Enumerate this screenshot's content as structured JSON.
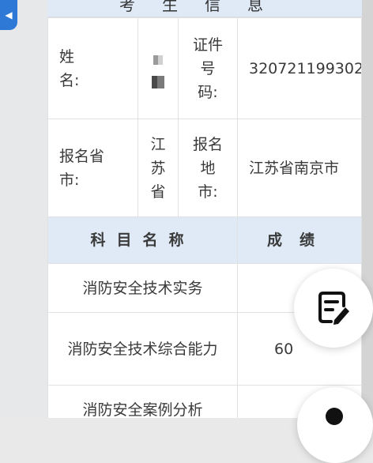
{
  "header": {
    "title": "考生信息"
  },
  "info": {
    "name_label": "姓名:",
    "id_label": "证件号码:",
    "id_value": "320721199302",
    "province_label": "报名省市:",
    "province_value": "江苏省",
    "city_label": "报名地市:",
    "city_value": "江苏省南京市"
  },
  "scores": {
    "subject_header": "科目名称",
    "score_header": "成绩",
    "rows": [
      {
        "subject": "消防安全技术实务",
        "score": ""
      },
      {
        "subject": "消防安全技术综合能力",
        "score": "60"
      },
      {
        "subject": "消防安全案例分析",
        "score": ""
      }
    ]
  },
  "icons": {
    "back": "chevron-left-icon",
    "edit": "edit-note-icon"
  },
  "colors": {
    "accent": "#2f79d6",
    "header_bg": "#dfeaf6"
  }
}
